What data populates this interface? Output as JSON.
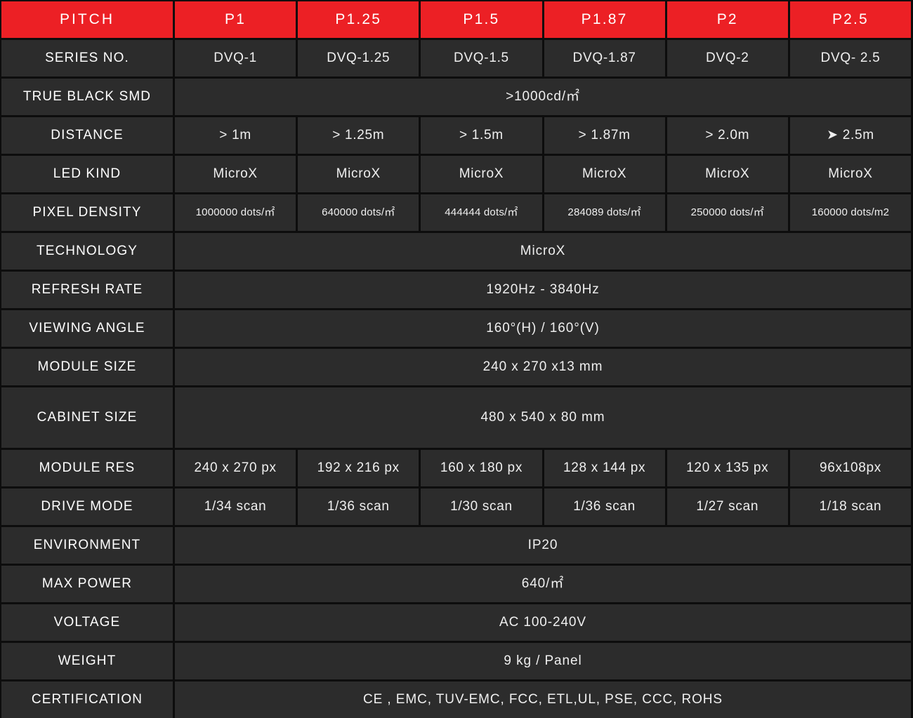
{
  "meta": {
    "accent_color": "#ec2025",
    "cell_background": "#2c2c2c",
    "page_background": "#0d0d0d",
    "text_color": "#efefef"
  },
  "header": {
    "label": "PITCH",
    "columns": [
      "P1",
      "P1.25",
      "P1.5",
      "P1.87",
      "P2",
      "P2.5"
    ]
  },
  "rows": [
    {
      "label": "SERIES NO.",
      "type": "cells",
      "values": [
        "DVQ-1",
        "DVQ-1.25",
        "DVQ-1.5",
        "DVQ-1.87",
        "DVQ-2",
        "DVQ- 2.5"
      ]
    },
    {
      "label": "TRUE BLACK SMD",
      "type": "merged",
      "value": ">1000cd/㎡"
    },
    {
      "label": "DISTANCE",
      "type": "cells",
      "values": [
        "> 1m",
        "> 1.25m",
        "> 1.5m",
        "> 1.87m",
        "> 2.0m",
        "➤  2.5m"
      ]
    },
    {
      "label": "LED KIND",
      "type": "cells",
      "values": [
        "MicroX",
        "MicroX",
        "MicroX",
        "MicroX",
        "MicroX",
        "MicroX"
      ]
    },
    {
      "label": "PIXEL DENSITY",
      "type": "cells",
      "small": true,
      "values": [
        "1000000 dots/㎡",
        "640000 dots/㎡",
        "444444 dots/㎡",
        "284089 dots/㎡",
        "250000 dots/㎡",
        "160000 dots/m2"
      ]
    },
    {
      "label": "TECHNOLOGY",
      "type": "merged",
      "value": "MicroX"
    },
    {
      "label": "REFRESH RATE",
      "type": "merged",
      "value": "1920Hz - 3840Hz"
    },
    {
      "label": "VIEWING ANGLE",
      "type": "merged",
      "value": "160°(H) / 160°(V)"
    },
    {
      "label": "MODULE SIZE",
      "type": "merged",
      "value": "240 x 270 x13 mm"
    },
    {
      "label": "CABINET SIZE",
      "type": "merged",
      "tall": true,
      "value": "480 x 540 x 80 mm"
    },
    {
      "label": "MODULE RES",
      "type": "cells",
      "values": [
        "240 x 270 px",
        "192 x 216 px",
        "160 x 180 px",
        "128 x 144 px",
        "120 x 135 px",
        "96x108px"
      ]
    },
    {
      "label": "DRIVE MODE",
      "type": "cells",
      "values": [
        "1/34 scan",
        "1/36 scan",
        "1/30 scan",
        "1/36 scan",
        "1/27 scan",
        "1/18 scan"
      ]
    },
    {
      "label": "ENVIRONMENT",
      "type": "merged",
      "value": "IP20"
    },
    {
      "label": "MAX POWER",
      "type": "merged",
      "value": "640/㎡"
    },
    {
      "label": "VOLTAGE",
      "type": "merged",
      "value": "AC 100-240V"
    },
    {
      "label": "WEIGHT",
      "type": "merged",
      "value": "9 kg / Panel"
    },
    {
      "label": "CERTIFICATION",
      "type": "merged",
      "value": "CE , EMC, TUV-EMC, FCC, ETL,UL, PSE, CCC, ROHS"
    }
  ]
}
